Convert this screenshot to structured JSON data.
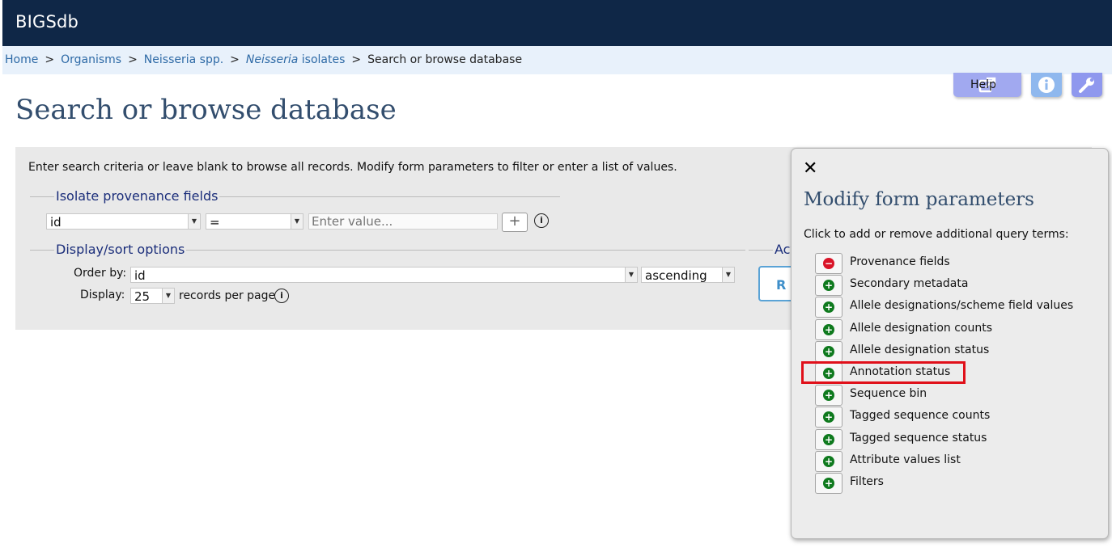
{
  "header": {
    "brand": "BIGSdb"
  },
  "breadcrumb": {
    "items": [
      "Home",
      "Organisms",
      "Neisseria spp."
    ],
    "isolates_italic": "Neisseria",
    "isolates_rest": " isolates",
    "current": "Search or browse database",
    "separator": ">"
  },
  "toolbar": {
    "help_label": "Help",
    "help_icon": "external-link-icon",
    "info_icon": "info-icon",
    "tools_icon": "wrench-icon"
  },
  "page": {
    "title": "Search or browse database"
  },
  "query": {
    "instructions": "Enter search criteria or leave blank to browse all records. Modify form parameters to filter or enter a list of values.",
    "provenance_legend": "Isolate provenance fields",
    "field_select": "id",
    "operator_select": "=",
    "value_placeholder": "Enter value...",
    "add_label": "+",
    "display_legend": "Display/sort options",
    "order_by_label": "Order by:",
    "order_by_value": "id",
    "direction_value": "ascending",
    "display_label": "Display:",
    "display_value": "25",
    "records_per_page": "records per page",
    "action_legend": "Act",
    "action_button": "R"
  },
  "modal": {
    "close": "✕",
    "title": "Modify form parameters",
    "subtitle": "Click to add or remove additional query terms:",
    "highlight_item": "Annotation status",
    "options": [
      {
        "label": "Provenance fields",
        "state": "remove"
      },
      {
        "label": "Secondary metadata",
        "state": "add"
      },
      {
        "label": "Allele designations/scheme field values",
        "state": "add"
      },
      {
        "label": "Allele designation counts",
        "state": "add"
      },
      {
        "label": "Allele designation status",
        "state": "add"
      },
      {
        "label": "Annotation status",
        "state": "add"
      },
      {
        "label": "Sequence bin",
        "state": "add"
      },
      {
        "label": "Tagged sequence counts",
        "state": "add"
      },
      {
        "label": "Tagged sequence status",
        "state": "add"
      },
      {
        "label": "Attribute values list",
        "state": "add"
      },
      {
        "label": "Filters",
        "state": "add"
      }
    ],
    "colors": {
      "remove": "#d91428",
      "add": "#0f7a1e",
      "highlight": "#e0101a"
    }
  }
}
